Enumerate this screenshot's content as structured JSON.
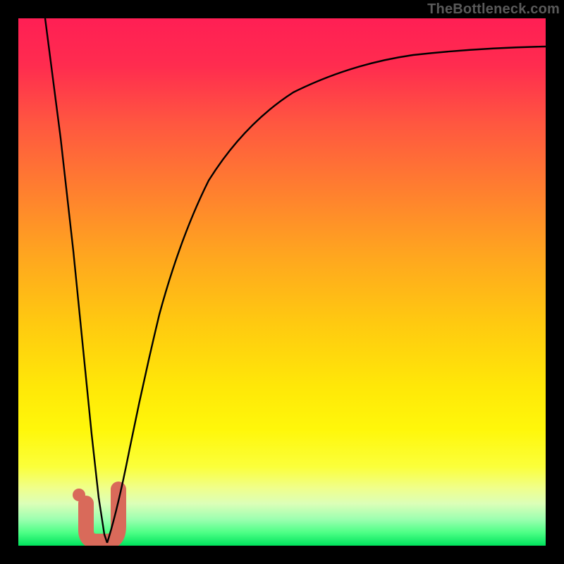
{
  "watermark": "TheBottleneck.com",
  "colors": {
    "frame": "#000000",
    "curve": "#000000",
    "highlight": "#d96a5a",
    "gradient_top": "#ff1f54",
    "gradient_mid": "#ffe808",
    "gradient_bottom": "#00e35d"
  },
  "chart_data": {
    "type": "line",
    "title": "",
    "xlabel": "",
    "ylabel": "",
    "xlim": [
      0,
      100
    ],
    "ylim": [
      0,
      100
    ],
    "grid": false,
    "legend": false,
    "annotations": [
      "TheBottleneck.com"
    ],
    "series": [
      {
        "name": "left-branch",
        "x": [
          5,
          8,
          10.5,
          12.3,
          13.9,
          15.2,
          16.3,
          16.9
        ],
        "values": [
          100,
          77,
          56,
          37,
          21,
          9,
          2,
          0.5
        ]
      },
      {
        "name": "right-branch",
        "x": [
          16.9,
          20.9,
          26.7,
          36.1,
          47.1,
          52.1,
          62.8,
          74.9,
          86.9,
          100
        ],
        "values": [
          0.5,
          17,
          44,
          69,
          82,
          86,
          90,
          93,
          94,
          94.7
        ]
      }
    ],
    "highlight": {
      "shape": "J-mark-with-dot",
      "x_range": [
        11.5,
        19
      ],
      "y_range": [
        0.8,
        10.7
      ],
      "color": "#d96a5a"
    },
    "background": {
      "style": "vertical-gradient",
      "meaning": "red-top to green-bottom heat scale"
    }
  }
}
